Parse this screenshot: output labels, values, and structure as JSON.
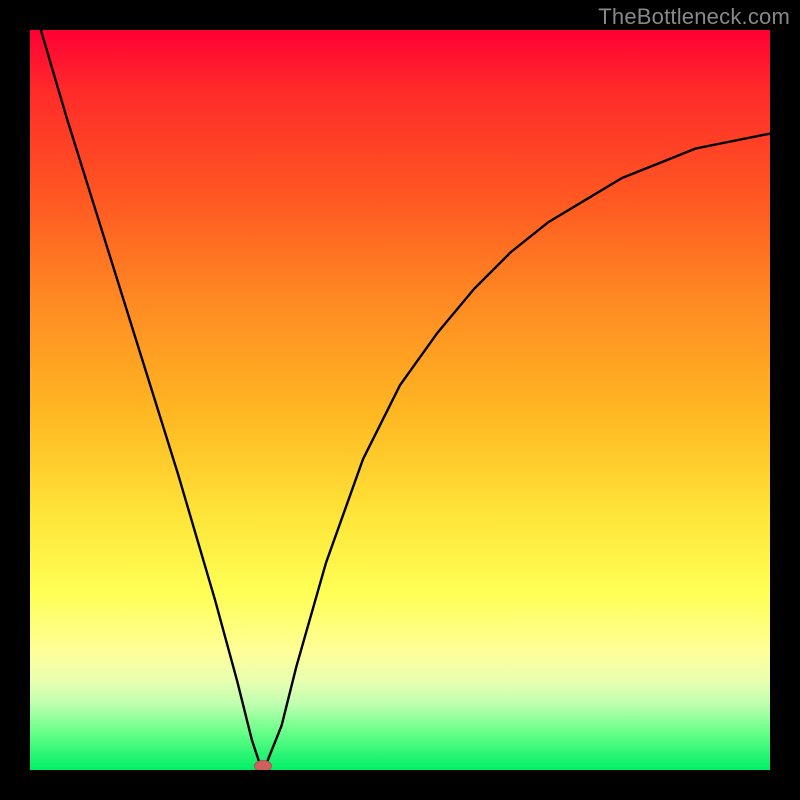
{
  "watermark": "TheBottleneck.com",
  "colors": {
    "frame_bg": "#000000",
    "marker_fill": "#d06060",
    "curve_stroke": "#000000"
  },
  "chart_data": {
    "type": "line",
    "title": "",
    "xlabel": "",
    "ylabel": "",
    "xlim": [
      0,
      100
    ],
    "ylim": [
      0,
      100
    ],
    "grid": false,
    "series": [
      {
        "name": "bottleneck-curve",
        "x": [
          0,
          5,
          10,
          15,
          20,
          25,
          28,
          30,
          31,
          32,
          34,
          36,
          40,
          45,
          50,
          55,
          60,
          65,
          70,
          75,
          80,
          85,
          90,
          95,
          100
        ],
        "values": [
          105,
          88,
          72,
          56,
          40,
          23,
          12,
          4,
          1,
          1,
          6,
          14,
          28,
          42,
          52,
          59,
          65,
          70,
          74,
          77,
          80,
          82,
          84,
          85,
          86
        ]
      }
    ],
    "marker": {
      "x": 31.5,
      "y": 0.5,
      "label": "optimal-point"
    },
    "gradient_stops": [
      {
        "pos": 0.0,
        "color": "#ff0033"
      },
      {
        "pos": 0.08,
        "color": "#ff2a2a"
      },
      {
        "pos": 0.22,
        "color": "#ff5522"
      },
      {
        "pos": 0.36,
        "color": "#ff8822"
      },
      {
        "pos": 0.52,
        "color": "#ffb822"
      },
      {
        "pos": 0.66,
        "color": "#ffe63a"
      },
      {
        "pos": 0.76,
        "color": "#ffff55"
      },
      {
        "pos": 0.84,
        "color": "#ffff99"
      },
      {
        "pos": 0.88,
        "color": "#e8ffb0"
      },
      {
        "pos": 0.91,
        "color": "#c0ffb0"
      },
      {
        "pos": 0.95,
        "color": "#66ff88"
      },
      {
        "pos": 1.0,
        "color": "#00ee66"
      }
    ]
  }
}
